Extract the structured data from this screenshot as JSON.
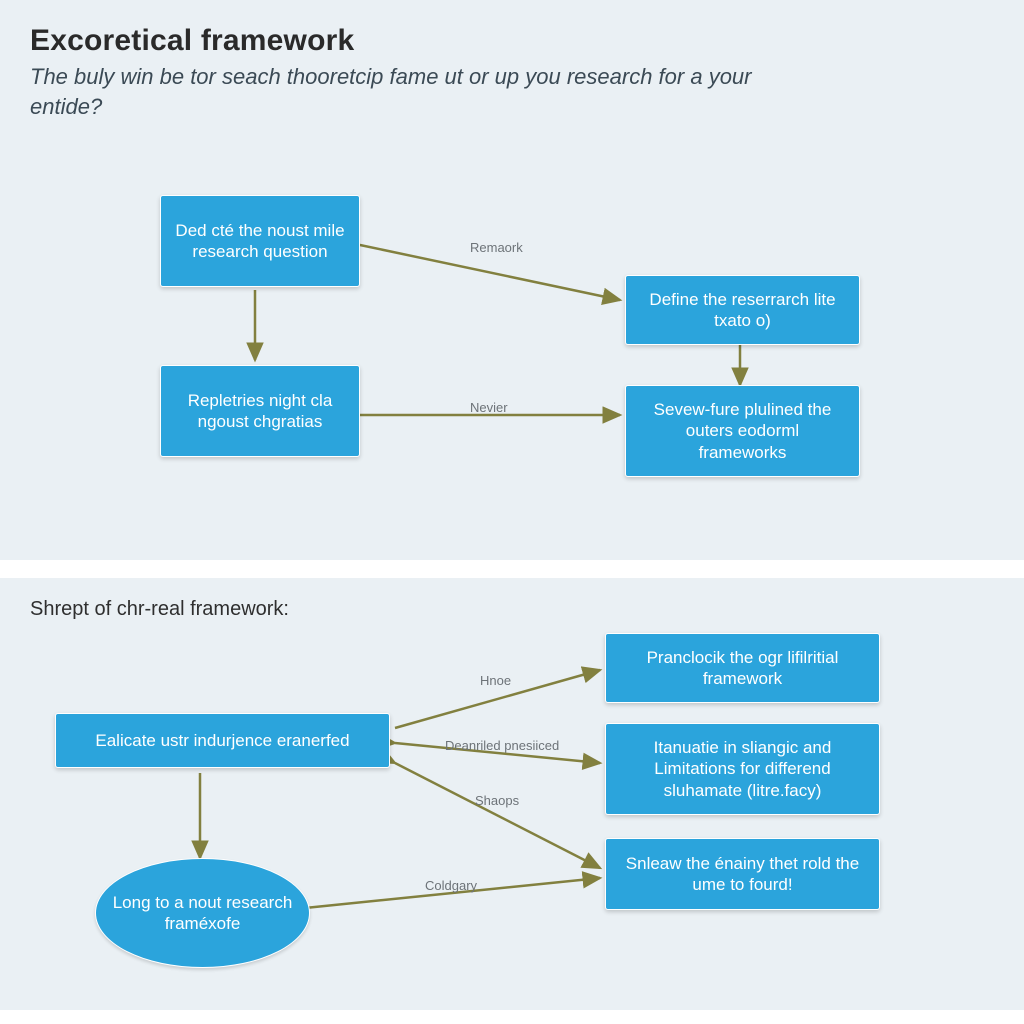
{
  "top": {
    "title": "Excoretical framework",
    "subtitle": "The buly win be tor seach thooretcip fame ut or up you research for a your entide?",
    "boxes": {
      "q": "Ded cté the noust mile research question",
      "d": "Define the reserrarch lite txato o)",
      "r": "Repletries night cla ngoust chgratias",
      "s": "Sevew-fure plulined the outers eodorml frameworks"
    },
    "edges": {
      "qd": "Remaork",
      "rs": "Nevier"
    }
  },
  "bottom": {
    "section": "Shrept of chr-real framework:",
    "boxes": {
      "e": "Ealicate ustr indurjence eranerfed",
      "p": "Pranclocik the ogr lifilritial framework",
      "i": "Itanuatie in sliangic and Limitations for differend sluhamate (litre.facy)",
      "n": "Snleaw the énainy thet rold the ume to fourd!"
    },
    "ellipse": {
      "l": "Long to a nout research framéxofe"
    },
    "edges": {
      "ep": "Hnoe",
      "ei": "Deanriled pnesiiced",
      "en": "Shaops",
      "ln": "Coldgary"
    }
  },
  "colors": {
    "box_bg": "#2ba4dc",
    "panel_bg": "#eaf0f4",
    "arrow": "#82803f"
  }
}
